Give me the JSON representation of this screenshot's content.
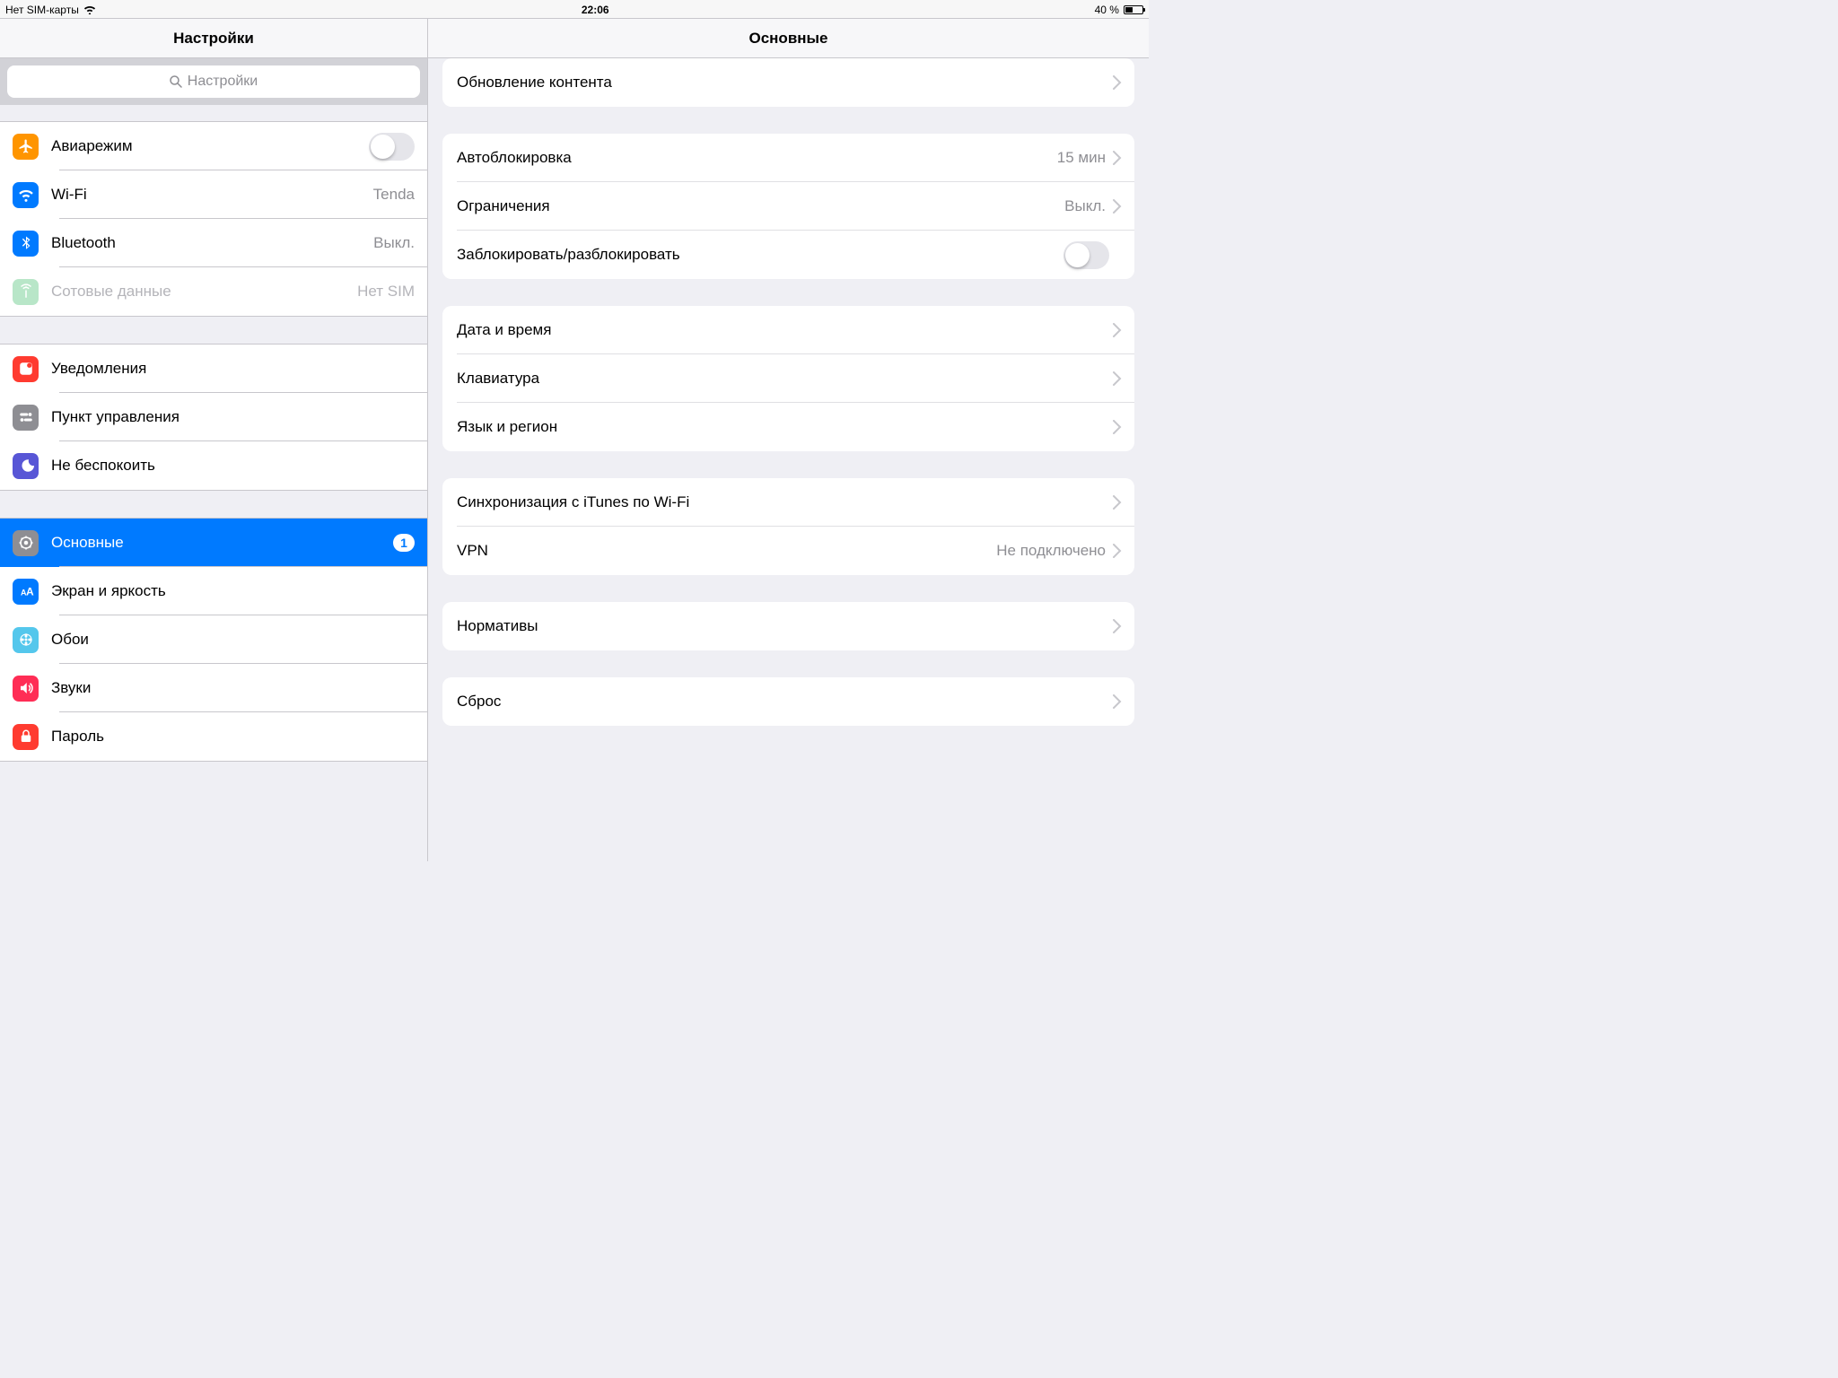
{
  "status": {
    "carrier": "Нет SIM-карты",
    "time": "22:06",
    "battery_pct": "40 %"
  },
  "sidebar": {
    "title": "Настройки",
    "search_placeholder": "Настройки",
    "group1": [
      {
        "icon": "airplane",
        "bg": "#ff9500",
        "label": "Авиарежим",
        "toggle": false
      },
      {
        "icon": "wifi",
        "bg": "#007aff",
        "label": "Wi-Fi",
        "value": "Tenda"
      },
      {
        "icon": "bluetooth",
        "bg": "#007aff",
        "label": "Bluetooth",
        "value": "Выкл."
      },
      {
        "icon": "cellular",
        "bg": "#b8e6c8",
        "label": "Сотовые данные",
        "value": "Нет SIM",
        "disabled": true
      }
    ],
    "group2": [
      {
        "icon": "notifications",
        "bg": "#ff3b30",
        "label": "Уведомления"
      },
      {
        "icon": "control",
        "bg": "#8e8e93",
        "label": "Пункт управления"
      },
      {
        "icon": "dnd",
        "bg": "#5856d6",
        "label": "Не беспокоить"
      }
    ],
    "group3": [
      {
        "icon": "general",
        "bg": "#8e8e93",
        "label": "Основные",
        "badge": "1",
        "selected": true
      },
      {
        "icon": "display",
        "bg": "#007aff",
        "label": "Экран и яркость"
      },
      {
        "icon": "wallpaper",
        "bg": "#54c7ec",
        "label": "Обои"
      },
      {
        "icon": "sounds",
        "bg": "#ff2d55",
        "label": "Звуки"
      },
      {
        "icon": "passcode",
        "bg": "#ff3b30",
        "label": "Пароль"
      }
    ]
  },
  "content": {
    "title": "Основные",
    "g1": [
      {
        "label": "Обновление контента"
      }
    ],
    "g2": [
      {
        "label": "Автоблокировка",
        "value": "15 мин"
      },
      {
        "label": "Ограничения",
        "value": "Выкл."
      },
      {
        "label": "Заблокировать/разблокировать",
        "toggle": false
      }
    ],
    "g3": [
      {
        "label": "Дата и время"
      },
      {
        "label": "Клавиатура"
      },
      {
        "label": "Язык и регион"
      }
    ],
    "g4": [
      {
        "label": "Синхронизация с iTunes по Wi-Fi"
      },
      {
        "label": "VPN",
        "value": "Не подключено"
      }
    ],
    "g5": [
      {
        "label": "Нормативы"
      }
    ],
    "g6": [
      {
        "label": "Сброс"
      }
    ]
  }
}
